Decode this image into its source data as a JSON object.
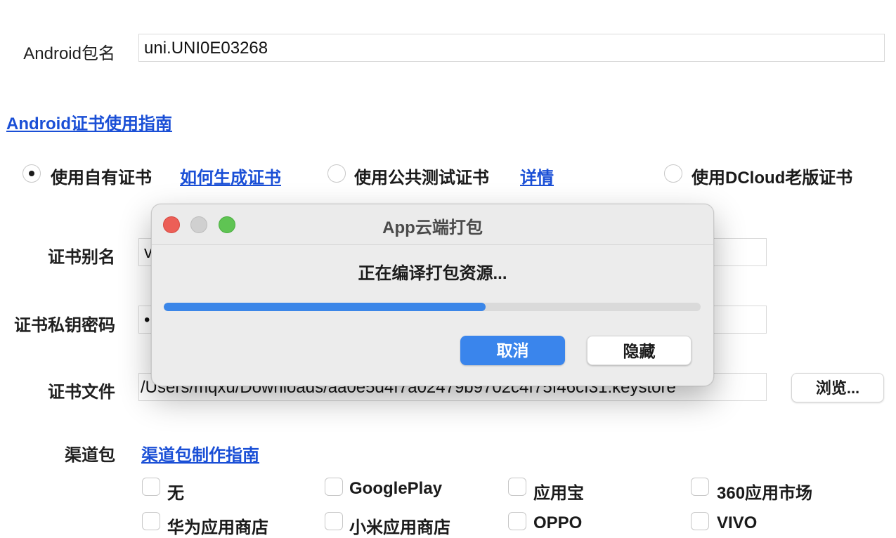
{
  "form": {
    "android_package": {
      "label": "Android包名",
      "value": "uni.UNI0E03268"
    },
    "cert_guide_link": "Android证书使用指南",
    "cert_options": [
      {
        "label": "使用自有证书",
        "checked": true,
        "link": "如何生成证书"
      },
      {
        "label": "使用公共测试证书",
        "checked": false,
        "link": "详情"
      },
      {
        "label": "使用DCloud老版证书",
        "checked": false
      }
    ],
    "cert_alias": {
      "label": "证书别名",
      "value": "v"
    },
    "cert_password": {
      "label": "证书私钥密码",
      "value": "•"
    },
    "cert_file": {
      "label": "证书文件",
      "value": "/Users/mqxu/Downloads/aa0e5d4f7a02479b9702c4f75f46cf31.keystore"
    },
    "browse_button": "浏览...",
    "channel": {
      "label": "渠道包",
      "link": "渠道包制作指南"
    },
    "channels": [
      {
        "label": "无",
        "checked": false
      },
      {
        "label": "GooglePlay",
        "checked": false
      },
      {
        "label": "应用宝",
        "checked": false
      },
      {
        "label": "360应用市场",
        "checked": false
      },
      {
        "label": "华为应用商店",
        "checked": false
      },
      {
        "label": "小米应用商店",
        "checked": false
      },
      {
        "label": "OPPO",
        "checked": false
      },
      {
        "label": "VIVO",
        "checked": false
      }
    ]
  },
  "dialog": {
    "title": "App云端打包",
    "status": "正在编译打包资源...",
    "progress": 0.6,
    "cancel_button": "取消",
    "hide_button": "隐藏",
    "colors": {
      "close": "#ec5f57",
      "minimize": "#d0d0d0",
      "zoom": "#5fc453",
      "accent": "#3a85ec"
    }
  }
}
